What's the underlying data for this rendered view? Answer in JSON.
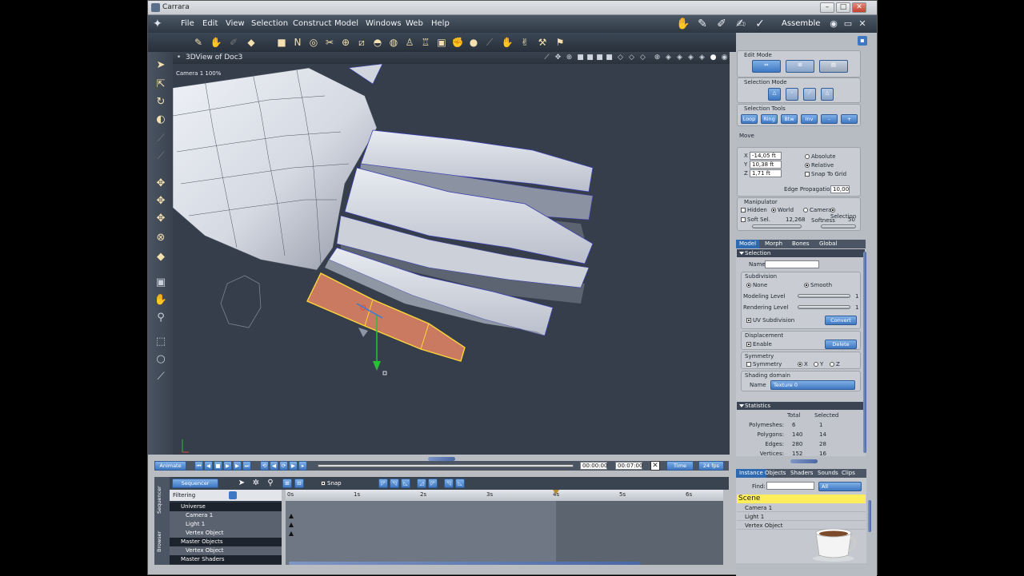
{
  "window": {
    "title": "Carrara",
    "controls": [
      "–",
      "□",
      "✕"
    ]
  },
  "menu": {
    "items": [
      "File",
      "Edit",
      "View",
      "Selection",
      "Construct",
      "Model",
      "Windows",
      "Web",
      "Help"
    ],
    "room": "Assemble"
  },
  "view": {
    "title": "3DView of Doc3",
    "camera_label": "Camera 1 100%"
  },
  "panel": {
    "edit_mode_label": "Edit Mode",
    "selection_mode_label": "Selection Mode",
    "selection_tools_label": "Selection Tools",
    "selection_tools": [
      "Loop",
      "Ring",
      "Btw",
      "Inv",
      "-",
      "+"
    ],
    "move_label": "Move",
    "x_label": "X",
    "x_value": "-14,05 ft",
    "y_label": "Y",
    "y_value": "10,38 ft",
    "z_label": "Z",
    "z_value": "1,71 ft",
    "absolute": "Absolute",
    "relative": "Relative",
    "snap_to_grid": "Snap To Grid",
    "edge_propagation_label": "Edge Propagation",
    "edge_propagation_value": "10,00",
    "manipulator_label": "Manipulator",
    "manip_hidden": "Hidden",
    "manip_world": "World",
    "manip_camera": "Camera",
    "manip_selection": "Selection",
    "soft_sel": "Soft Sel.",
    "soft_sel_value": "12,268",
    "softness": "Softness",
    "softness_value": "50"
  },
  "props": {
    "tabs": [
      "Model",
      "Morph",
      "Bones",
      "Global"
    ],
    "selection_header": "Selection",
    "name_label": "Name",
    "subdivision_label": "Subdivision",
    "none": "None",
    "smooth": "Smooth",
    "modeling_level": "Modeling Level",
    "modeling_level_value": "1",
    "rendering_level": "Rendering Level",
    "rendering_level_value": "1",
    "uv_subdivision": "UV Subdivision",
    "convert": "Convert",
    "displacement_label": "Displacement",
    "enable": "Enable",
    "delete": "Delete",
    "symmetry_label": "Symmetry",
    "symmetry": "Symmetry",
    "sym_x": "X",
    "sym_y": "Y",
    "sym_z": "Z",
    "shading_domain_label": "Shading domain",
    "shading_name_label": "Name",
    "shading_domain_value": "Texture 0",
    "statistics_header": "Statistics",
    "stat_cols": [
      "Total",
      "Selected"
    ],
    "stats": [
      {
        "label": "Polymeshes:",
        "total": "6",
        "selected": "1"
      },
      {
        "label": "Polygons:",
        "total": "140",
        "selected": "14"
      },
      {
        "label": "Edges:",
        "total": "280",
        "selected": "28"
      },
      {
        "label": "Vertices:",
        "total": "152",
        "selected": "16"
      }
    ]
  },
  "animation": {
    "animate": "Animate",
    "time_current": "00:00:00",
    "time_end": "00:07:00",
    "time_mode": "Time",
    "fps": "24 fps",
    "sequencer": "Sequencer",
    "snap": "Snap",
    "filtering": "Filtering",
    "side_tabs": [
      "Sequencer",
      "Browser"
    ],
    "ruler": [
      "0s",
      "1s",
      "2s",
      "3s",
      "4s",
      "5s",
      "6s"
    ],
    "tree": [
      {
        "label": "Universe",
        "type": "group"
      },
      {
        "label": "Camera 1",
        "type": "item"
      },
      {
        "label": "Light 1",
        "type": "item"
      },
      {
        "label": "Vertex Object",
        "type": "item"
      },
      {
        "label": "Master Objects",
        "type": "group"
      },
      {
        "label": "Vertex Object",
        "type": "item"
      },
      {
        "label": "Master Shaders",
        "type": "group"
      }
    ]
  },
  "browser": {
    "tabs": [
      "Instance",
      "Objects",
      "Shaders",
      "Sounds",
      "Clips"
    ],
    "find_label": "Find:",
    "find_scope": "All",
    "scene": "Scene",
    "items": [
      "Camera 1",
      "Light 1",
      "Vertex Object"
    ]
  },
  "colors": {
    "accent": "#3f78c2",
    "selection": "#ffe44c",
    "viewport": "#363e4c",
    "mesh_selected": "#d27b5c"
  }
}
